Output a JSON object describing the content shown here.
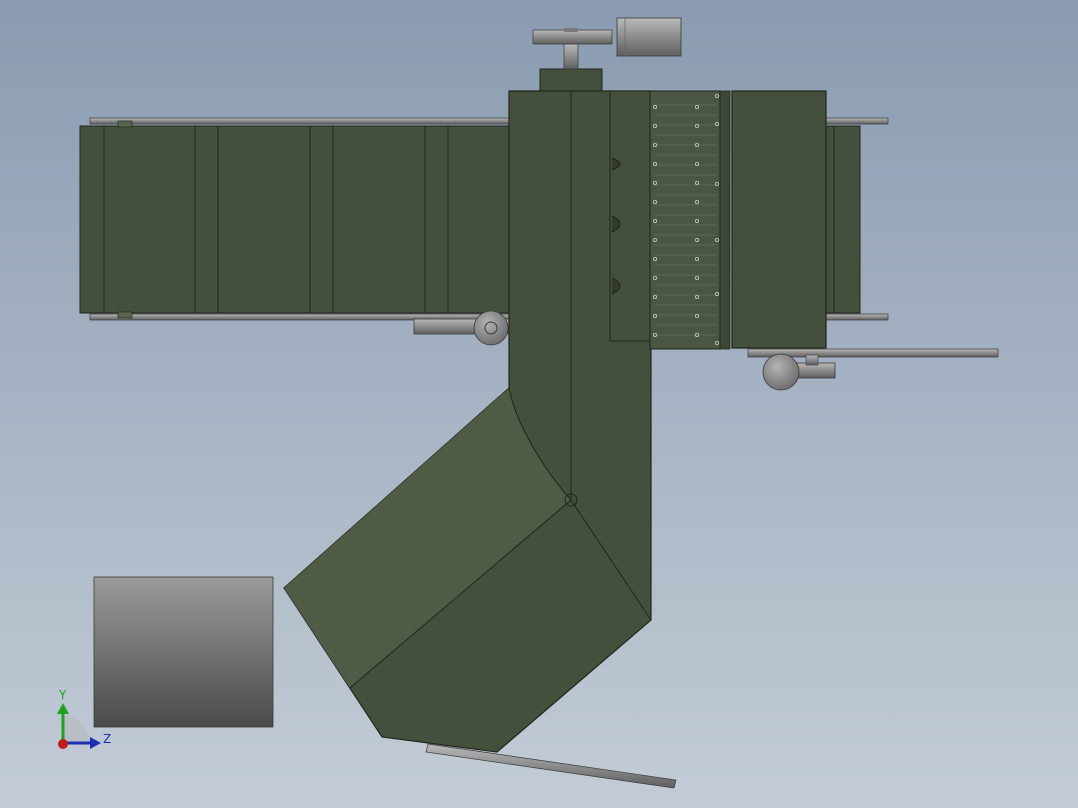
{
  "viewport": {
    "background_top": "#8a9bb1",
    "background_bottom": "#c3ccd6"
  },
  "model": {
    "body_color": "#44503c",
    "edge_color": "#1f261b",
    "metal_color": "#8f8f8f"
  },
  "triad": {
    "y_label": "Y",
    "z_label": "Z",
    "y_color": "#1fa21f",
    "z_color": "#1c2fb3",
    "x_color": "#c01c1c"
  }
}
